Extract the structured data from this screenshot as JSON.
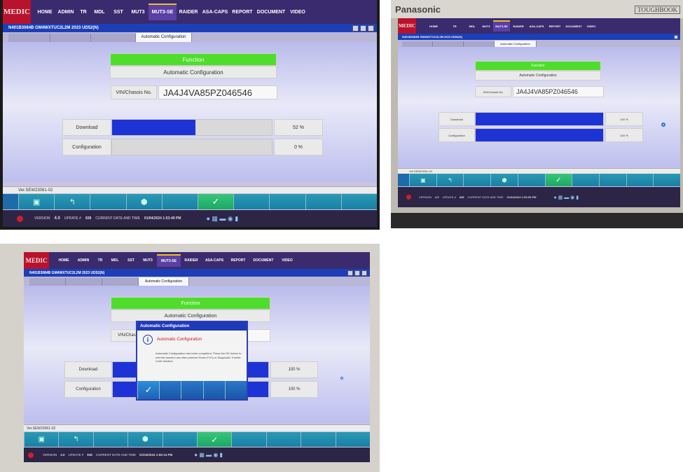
{
  "nav": {
    "logo": "MEDIC",
    "items": [
      "HOME",
      "ADMIN",
      "TR",
      "MDL",
      "SST",
      "MUT3",
      "MUT3-SE",
      "RAIDER",
      "ASA-CAPS",
      "REPORT",
      "DOCUMENT",
      "VIDEO"
    ]
  },
  "window": {
    "title": "N401B3084B GM4WXTUC2L2M 2023 UD52(N)"
  },
  "tabs": {
    "active": "Automatic Configuration"
  },
  "function": {
    "header": "Function",
    "name": "Automatic Configuration"
  },
  "vin": {
    "label": "VIN/Chassis No.",
    "value": "JA4J4VA85PZ046546"
  },
  "rows": {
    "download_label": "Download",
    "configuration_label": "Configuration"
  },
  "progress": {
    "photo1": {
      "download": 52,
      "download_text": "52 %",
      "configuration": 0,
      "configuration_text": "0 %"
    },
    "photo2": {
      "download": 100,
      "download_text": "100 %",
      "configuration": 100,
      "configuration_text": "100 %"
    },
    "photo3": {
      "download": 100,
      "download_text": "100 %",
      "configuration": 100,
      "configuration_text": "100 %"
    }
  },
  "status": {
    "version_text": "Ver.SEW23061-02"
  },
  "taskbar": {
    "version_label": "VERSION",
    "version_value": "4.0",
    "update_label": "UPDATE #",
    "update_value": "838",
    "datetime_label": "CURRENT DATE AND TIME",
    "datetime_photo1": "01/04/2024 1:53:49 PM",
    "datetime_photo2": "01/04/2024 1:53:09 PM",
    "datetime_photo3": "01/04/2024 1:55:14 PM"
  },
  "dialog": {
    "title": "Automatic Configuration",
    "heading": "Automatic Configuration",
    "message": "Automatic Configuration has been completed. Press the OK button to exit this function and then perform Erase DTCs in Diagnostic Trouble Code function."
  },
  "laptop": {
    "brand": "Panasonic",
    "model": "TOUGHBOOK"
  },
  "colors": {
    "progress_fill": "#1d33d6",
    "function_header": "#4fdd2c",
    "toolbar": "#1d6ba8",
    "nav": "#3a2b6e"
  }
}
